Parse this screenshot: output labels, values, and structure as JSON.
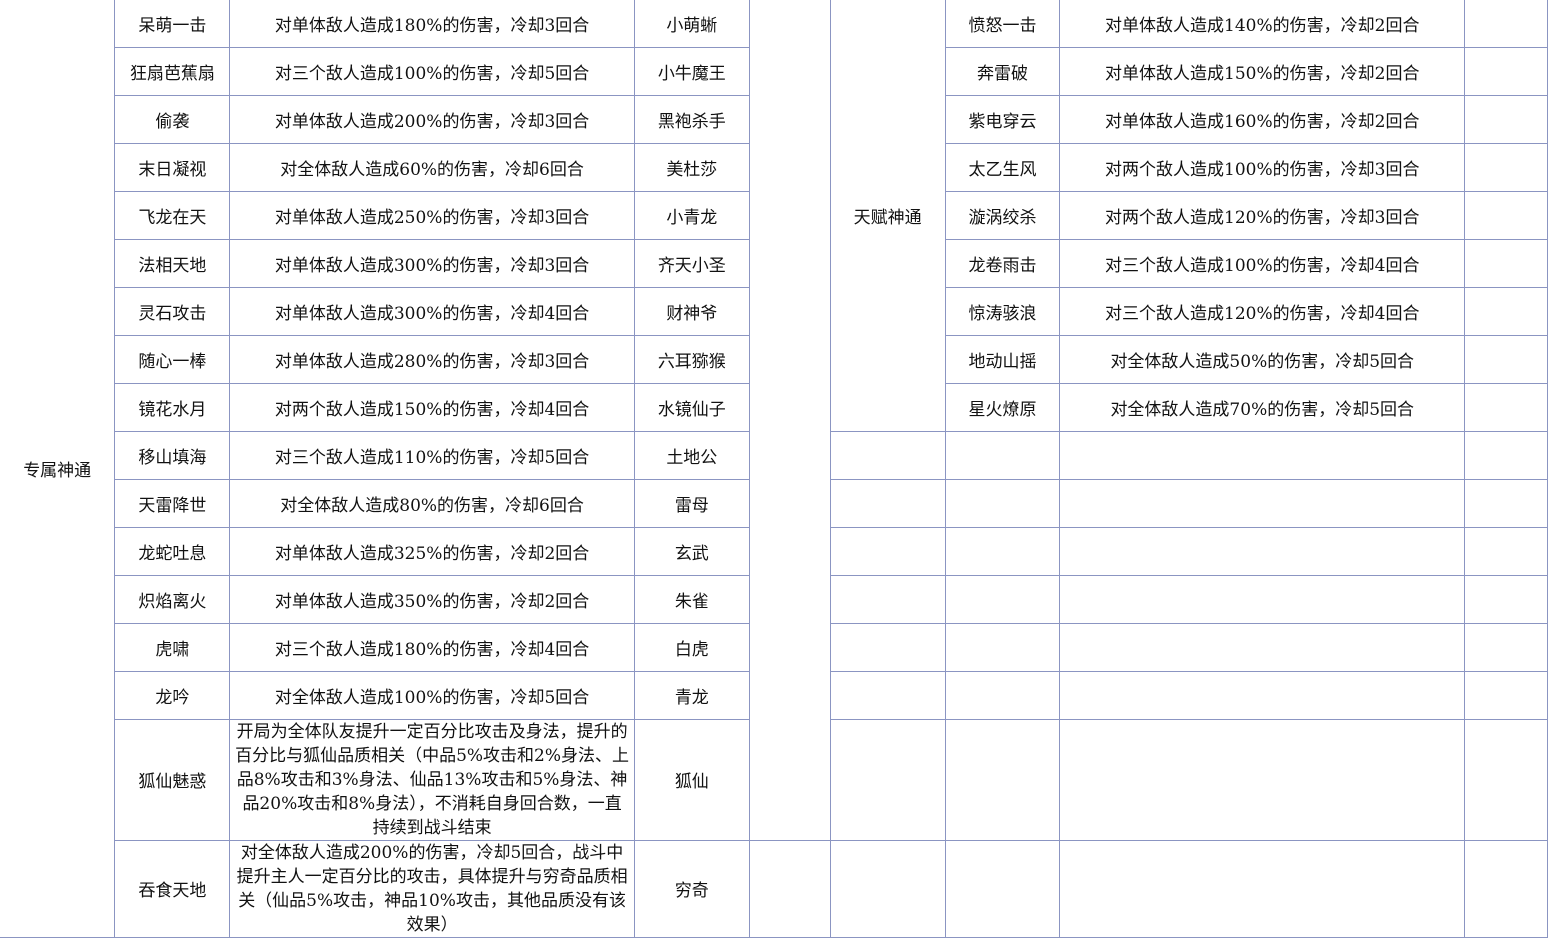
{
  "columns": [
    "",
    "",
    "",
    "",
    "",
    "",
    "",
    ""
  ],
  "left_group": {
    "category": "专属神通",
    "rows": [
      {
        "skill": "呆萌一击",
        "effect": "对单体敌人造成180%的伤害，冷却3回合",
        "pet": "小萌蜥"
      },
      {
        "skill": "狂扇芭蕉扇",
        "effect": "对三个敌人造成100%的伤害，冷却5回合",
        "pet": "小牛魔王"
      },
      {
        "skill": "偷袭",
        "effect": "对单体敌人造成200%的伤害，冷却3回合",
        "pet": "黑袍杀手"
      },
      {
        "skill": "末日凝视",
        "effect": "对全体敌人造成60%的伤害，冷却6回合",
        "pet": "美杜莎"
      },
      {
        "skill": "飞龙在天",
        "effect": "对单体敌人造成250%的伤害，冷却3回合",
        "pet": "小青龙"
      },
      {
        "skill": "法相天地",
        "effect": "对单体敌人造成300%的伤害，冷却3回合",
        "pet": "齐天小圣"
      },
      {
        "skill": "灵石攻击",
        "effect": "对单体敌人造成300%的伤害，冷却4回合",
        "pet": "财神爷"
      },
      {
        "skill": "随心一棒",
        "effect": "对单体敌人造成280%的伤害，冷却3回合",
        "pet": "六耳猕猴"
      },
      {
        "skill": "镜花水月",
        "effect": "对两个敌人造成150%的伤害，冷却4回合",
        "pet": "水镜仙子"
      },
      {
        "skill": "移山填海",
        "effect": "对三个敌人造成110%的伤害，冷却5回合",
        "pet": "土地公"
      },
      {
        "skill": "天雷降世",
        "effect": "对全体敌人造成80%的伤害，冷却6回合",
        "pet": "雷母"
      },
      {
        "skill": "龙蛇吐息",
        "effect": "对单体敌人造成325%的伤害，冷却2回合",
        "pet": "玄武"
      },
      {
        "skill": "炽焰离火",
        "effect": "对单体敌人造成350%的伤害，冷却2回合",
        "pet": "朱雀"
      },
      {
        "skill": "虎啸",
        "effect": "对三个敌人造成180%的伤害，冷却4回合",
        "pet": "白虎"
      },
      {
        "skill": "龙吟",
        "effect": "对全体敌人造成100%的伤害，冷却5回合",
        "pet": "青龙"
      },
      {
        "skill": "狐仙魅惑",
        "effect": "开局为全体队友提升一定百分比攻击及身法，提升的百分比与狐仙品质相关（中品5%攻击和2%身法、上品8%攻击和3%身法、仙品13%攻击和5%身法、神品20%攻击和8%身法），不消耗自身回合数，一直持续到战斗结束",
        "pet": "狐仙"
      },
      {
        "skill": "吞食天地",
        "effect": "对全体敌人造成200%的伤害，冷却5回合，战斗中提升主人一定百分比的攻击，具体提升与穷奇品质相关（仙品5%攻击，神品10%攻击，其他品质没有该效果）",
        "pet": "穷奇"
      }
    ]
  },
  "right_group": {
    "category": "天赋神通",
    "rows": [
      {
        "skill": "愤怒一击",
        "effect": "对单体敌人造成140%的伤害，冷却2回合"
      },
      {
        "skill": "奔雷破",
        "effect": "对单体敌人造成150%的伤害，冷却2回合"
      },
      {
        "skill": "紫电穿云",
        "effect": "对单体敌人造成160%的伤害，冷却2回合"
      },
      {
        "skill": "太乙生风",
        "effect": "对两个敌人造成100%的伤害，冷却3回合"
      },
      {
        "skill": "漩涡绞杀",
        "effect": "对两个敌人造成120%的伤害，冷却3回合"
      },
      {
        "skill": "龙卷雨击",
        "effect": "对三个敌人造成100%的伤害，冷却4回合"
      },
      {
        "skill": "惊涛骇浪",
        "effect": "对三个敌人造成120%的伤害，冷却4回合"
      },
      {
        "skill": "地动山摇",
        "effect": "对全体敌人造成50%的伤害，冷却5回合"
      },
      {
        "skill": "星火燎原",
        "effect": "对全体敌人造成70%的伤害，冷却5回合"
      }
    ]
  }
}
